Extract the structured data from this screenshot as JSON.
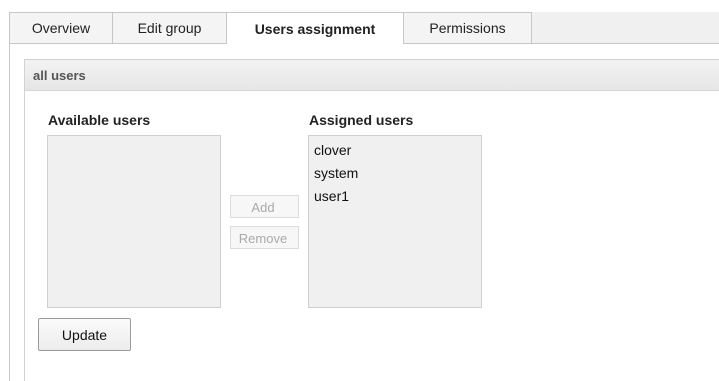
{
  "tabs": {
    "overview": "Overview",
    "edit_group": "Edit group",
    "users_assignment": "Users assignment",
    "permissions": "Permissions"
  },
  "section": {
    "title": "all users"
  },
  "available": {
    "label": "Available users",
    "items": []
  },
  "assigned": {
    "label": "Assigned users",
    "items": [
      "clover",
      "system",
      "user1"
    ]
  },
  "actions": {
    "add": "Add",
    "remove": "Remove",
    "update": "Update"
  }
}
